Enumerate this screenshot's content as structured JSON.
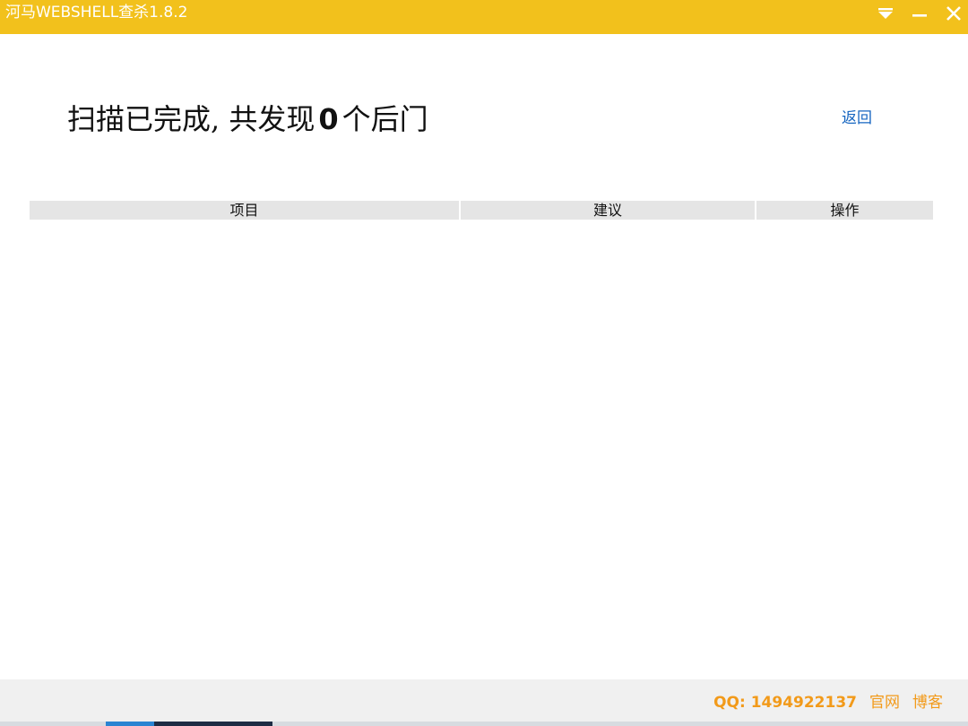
{
  "window": {
    "title": "河马WEBSHELL查杀1.8.2",
    "accent": "#f2c11c",
    "controls": {
      "menu_icon": "dropdown-triangle-icon",
      "minimize_icon": "minimize-icon",
      "close_icon": "close-icon"
    }
  },
  "result": {
    "prefix": "扫描已完成, 共发现",
    "count": "0",
    "suffix": "个后门",
    "back_label": "返回"
  },
  "table": {
    "columns": [
      "项目",
      "建议",
      "操作"
    ],
    "rows": []
  },
  "footer": {
    "qq": "QQ: 1494922137",
    "official_site": "官网",
    "blog": "博客",
    "link_color": "#f29a1a"
  }
}
